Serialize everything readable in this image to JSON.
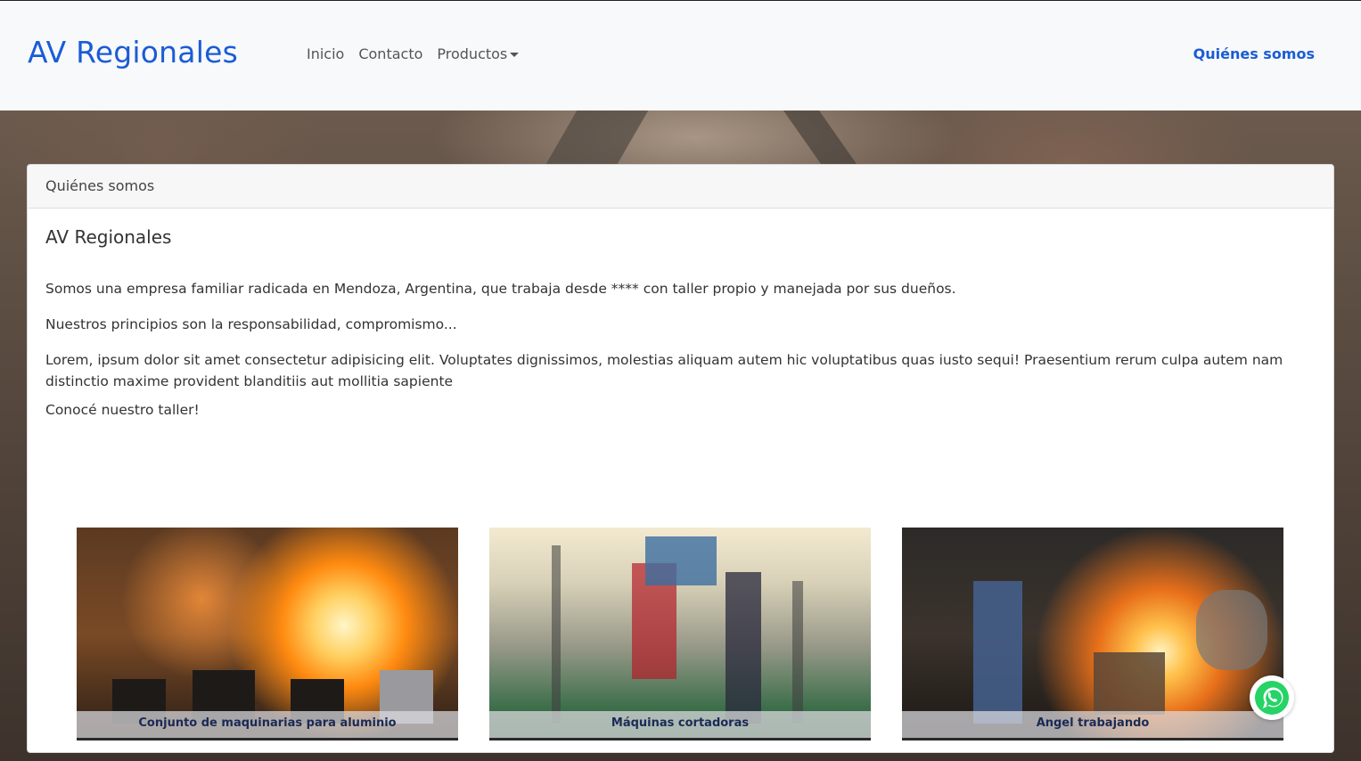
{
  "navbar": {
    "brand": "AV Regionales",
    "links": [
      "Inicio",
      "Contacto",
      "Productos"
    ],
    "right_link": "Quiénes somos"
  },
  "card": {
    "header": "Quiénes somos",
    "title": "AV Regionales",
    "paragraphs": [
      "Somos una empresa familiar radicada en Mendoza, Argentina, que trabaja desde **** con taller propio y manejada por sus dueños.",
      "Nuestros principios son la responsabilidad, compromismo...",
      "Lorem, ipsum dolor sit amet consectetur adipisicing elit. Voluptates dignissimos, molestias aliquam autem hic voluptatibus quas iusto sequi! Praesentium rerum culpa autem nam distinctio maxime provident blanditiis aut mollitia sapiente",
      "Conocé nuestro taller!"
    ],
    "gallery": [
      {
        "caption": "Conjunto de maquinarias para aluminio"
      },
      {
        "caption": "Máquinas cortadoras"
      },
      {
        "caption": "Angel trabajando"
      }
    ]
  },
  "colors": {
    "brand": "#1a5cd6",
    "whatsapp": "#25d366"
  },
  "icons": {
    "whatsapp": "whatsapp-icon",
    "caret": "caret-down-icon"
  }
}
